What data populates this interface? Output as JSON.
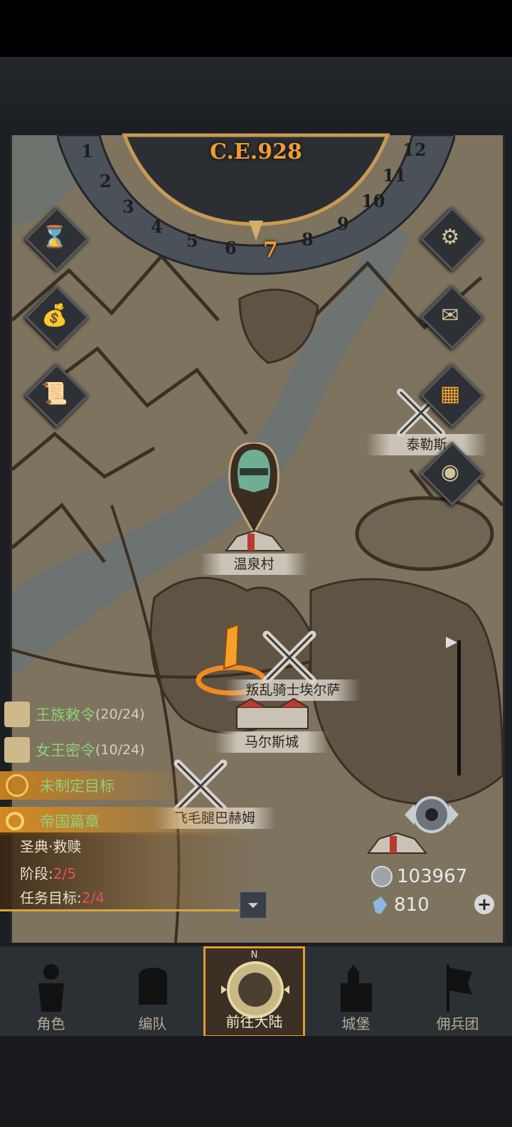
{
  "era": "C.E.928",
  "months": [
    "1",
    "2",
    "3",
    "4",
    "5",
    "6",
    "7",
    "8",
    "9",
    "10",
    "11",
    "12"
  ],
  "active_month": "7",
  "locations": {
    "tailes": "泰勒斯",
    "hot_spring": "温泉村",
    "rebel_knight": "叛乱骑士埃尔萨",
    "marls_city": "马尔斯城",
    "flying_leg": "飞毛腿巴赫姆"
  },
  "quests": {
    "royal_order": {
      "title": "王族敕令",
      "count": "(20/24)"
    },
    "queen_order": {
      "title": "女王密令",
      "count": "(10/24)"
    },
    "no_goal": "未制定目标",
    "empire_chapter": "帝国篇章",
    "chapter_name": "圣典·救赎",
    "stage_label": "阶段:",
    "stage_value": "2/5",
    "task_label": "任务目标:",
    "task_value": "2/4"
  },
  "resources": {
    "silver": "103967",
    "crystal": "810"
  },
  "nav": {
    "role": "角色",
    "formation": "编队",
    "continent": "前往大陆",
    "castle": "城堡",
    "mercenary": "佣兵团"
  },
  "compass_letter": "N",
  "colors": {
    "accent": "#f09a35",
    "quest_green": "#8fd07a",
    "progress_red": "#e0554f"
  },
  "icons": [
    "hourglass-icon",
    "bag-icon",
    "scroll-icon",
    "gear-icon",
    "mail-icon",
    "grid-icon",
    "coin-icon",
    "locate-icon"
  ]
}
